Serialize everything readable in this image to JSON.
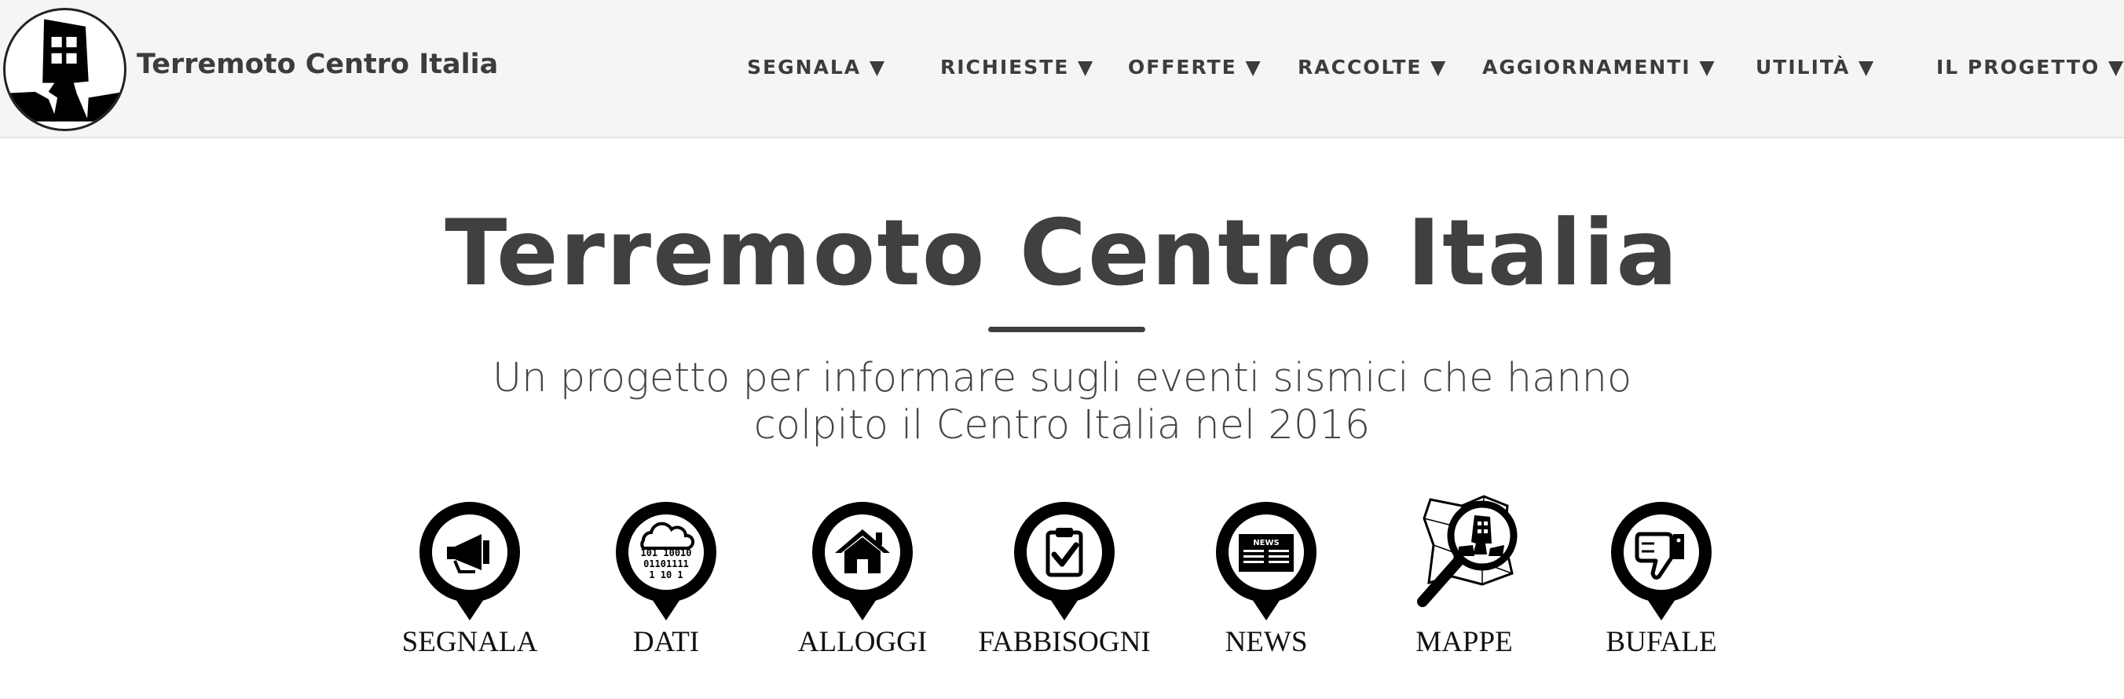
{
  "brand": {
    "title": "Terremoto Centro Italia"
  },
  "nav": {
    "items": [
      {
        "label": "SEGNALA ▼"
      },
      {
        "label": "RICHIESTE ▼"
      },
      {
        "label": "OFFERTE ▼"
      },
      {
        "label": "RACCOLTE ▼"
      },
      {
        "label": "AGGIORNAMENTI ▼"
      },
      {
        "label": "UTILITÀ ▼"
      },
      {
        "label": "IL PROGETTO ▼"
      }
    ]
  },
  "hero": {
    "title": "Terremoto Centro Italia",
    "subtitle_line1": "Un progetto per informare sugli eventi sismici che hanno",
    "subtitle_line2": "colpito il Centro Italia nel 2016"
  },
  "tiles": [
    {
      "label": "SEGNALA",
      "icon": "megaphone-icon"
    },
    {
      "label": "DATI",
      "icon": "data-cloud-icon",
      "icon_text": [
        "101 10010",
        "01101111",
        "1 10 1"
      ]
    },
    {
      "label": "ALLOGGI",
      "icon": "house-icon"
    },
    {
      "label": "FABBISOGNI",
      "icon": "clipboard-check-icon"
    },
    {
      "label": "NEWS",
      "icon": "newspaper-icon",
      "icon_text": "NEWS"
    },
    {
      "label": "MAPPE",
      "icon": "map-magnifier-icon"
    },
    {
      "label": "BUFALE",
      "icon": "thumbs-down-icon"
    }
  ],
  "colors": {
    "navbar_bg": "#f5f5f5",
    "text": "#404040",
    "icon": "#000000"
  }
}
